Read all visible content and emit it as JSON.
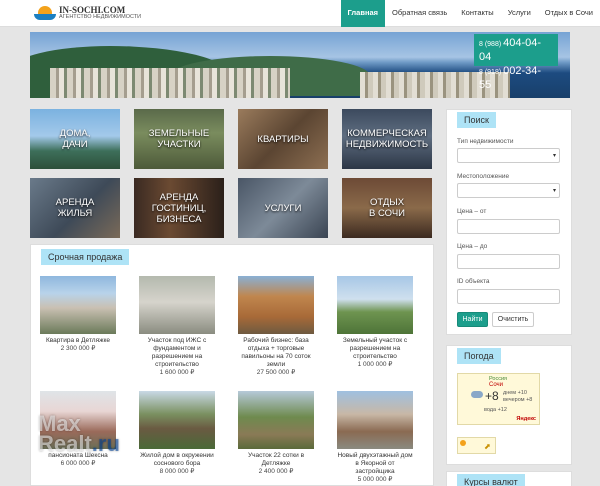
{
  "header": {
    "logo_title": "IN-SOCHI.COM",
    "logo_subtitle": "АГЕНТСТВО НЕДВИЖИМОСТИ",
    "nav": [
      {
        "label": "Главная",
        "active": true
      },
      {
        "label": "Обратная связь"
      },
      {
        "label": "Контакты"
      },
      {
        "label": "Услуги"
      },
      {
        "label": "Отдых в Сочи"
      }
    ]
  },
  "hero": {
    "phone1_prefix": "8 (988)",
    "phone1_number": "404-04-04",
    "phone2_prefix": "8 (918)",
    "phone2_number": "002-34-55"
  },
  "categories": [
    {
      "label": "ДОМА,\nДАЧИ"
    },
    {
      "label": "ЗЕМЕЛЬНЫЕ\nУЧАСТКИ"
    },
    {
      "label": "КВАРТИРЫ"
    },
    {
      "label": "КОММЕРЧЕСКАЯ\nНЕДВИЖИМОСТЬ"
    },
    {
      "label": "АРЕНДА\nЖИЛЬЯ"
    },
    {
      "label": "АРЕНДА\nГОСТИНИЦ,\nБИЗНЕСА"
    },
    {
      "label": "УСЛУГИ"
    },
    {
      "label": "ОТДЫХ\nВ СОЧИ"
    }
  ],
  "sale": {
    "title": "Срочная продажа",
    "items": [
      {
        "title": "Квартира в Детляжке",
        "price": "2 300 000 ₽"
      },
      {
        "title": "Участок под ИЖС с фундаментом и разрешением на строительство",
        "price": "1 600 000 ₽"
      },
      {
        "title": "Рабочий бизнес: база отдыха + торговые павильоны на 70 соток земли",
        "price": "27 500 000 ₽"
      },
      {
        "title": "Земельный участок с разрешением на строительство",
        "price": "1 000 000 ₽"
      },
      {
        "title": "пансионата Шексна",
        "price": "6 000 000 ₽"
      },
      {
        "title": "Жилой дом в окружении соснового бора",
        "price": "8 000 000 ₽"
      },
      {
        "title": "Участок 22 сотки в Детляжке",
        "price": "2 400 000 ₽"
      },
      {
        "title": "Новый двухэтажный дом в Якорной от застройщика",
        "price": "5 000 000 ₽"
      }
    ]
  },
  "search": {
    "title": "Поиск",
    "type_label": "Тип недвижимости",
    "location_label": "Местоположение",
    "price_from_label": "Цена – от",
    "price_to_label": "Цена – до",
    "id_label": "ID объекта",
    "find_button": "Найти",
    "clear_button": "Очистить"
  },
  "weather": {
    "title": "Погода",
    "country": "Россия",
    "city": "Сочи",
    "temp": "+8",
    "day_label": "днем +10",
    "evening_label": "вечером +8",
    "water_label": "вода +12",
    "source": "Яндекс"
  },
  "currency": {
    "title": "Курсы валют"
  },
  "watermark": {
    "part1": "Max",
    "part2": "Realt",
    "part3": ".ru"
  }
}
